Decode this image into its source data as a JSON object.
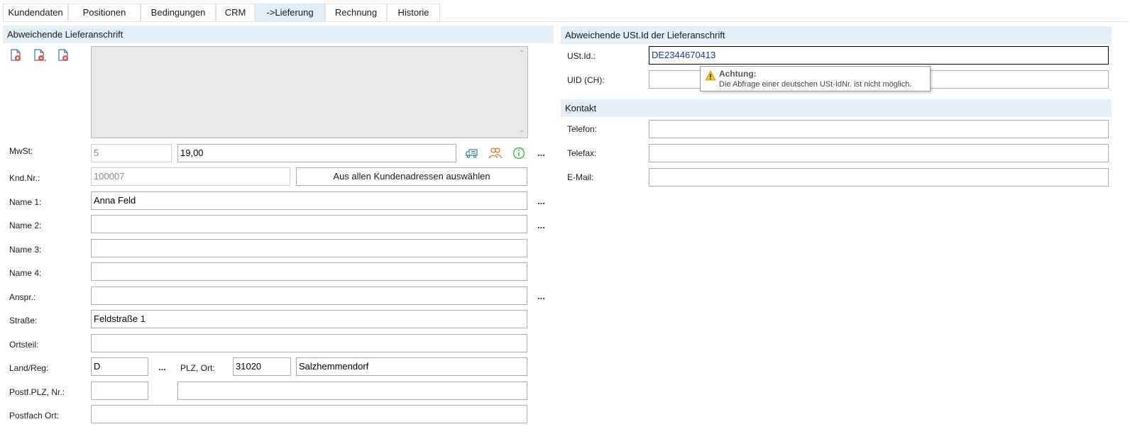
{
  "tabs": [
    {
      "label": "Kundendaten"
    },
    {
      "label": "Positionen"
    },
    {
      "label": "Bedingungen"
    },
    {
      "label": "CRM"
    },
    {
      "label": "->Lieferung"
    },
    {
      "label": "Rechnung"
    },
    {
      "label": "Historie"
    }
  ],
  "active_tab": "->Lieferung",
  "lieferanschrift": {
    "header": "Abweichende Lieferanschrift",
    "toolbar_icons": [
      "document-add-icon",
      "document-copy-icon",
      "document-delete-icon"
    ],
    "mwst": {
      "label": "MwSt:",
      "code": "5",
      "rate": "19,00"
    },
    "kundennr": {
      "label": "Knd.Nr.:",
      "value": "100007",
      "button": "Aus allen Kundenadressen auswählen"
    },
    "name1": {
      "label": "Name 1:",
      "value": "Anna Feld"
    },
    "name2": {
      "label": "Name 2:",
      "value": ""
    },
    "name3": {
      "label": "Name 3:",
      "value": ""
    },
    "name4": {
      "label": "Name 4:",
      "value": ""
    },
    "anspr": {
      "label": "Anspr.:",
      "value": ""
    },
    "strasse": {
      "label": "Straße:",
      "value": "Feldstraße 1"
    },
    "ortsteil": {
      "label": "Ortsteil:",
      "value": ""
    },
    "land": {
      "label": "Land/Reg:",
      "value": "D"
    },
    "plz_ort": {
      "label": "PLZ, Ort:",
      "plz": "31020",
      "ort": "Salzhemmendorf"
    },
    "postfach": {
      "label": "Postf.PLZ, Nr.:",
      "plz": "",
      "nr": ""
    },
    "postfach_ort": {
      "label": "Postfach Ort:",
      "value": ""
    },
    "more_label": "..."
  },
  "ustid": {
    "header": "Abweichende USt.Id der Lieferanschrift",
    "ustid": {
      "label": "USt.Id.:",
      "value": "DE2344670413"
    },
    "uid": {
      "label": "UID (CH):",
      "value": ""
    }
  },
  "kontakt": {
    "header": "Kontakt",
    "telefon": {
      "label": "Telefon:",
      "value": ""
    },
    "telefax": {
      "label": "Telefax:",
      "value": ""
    },
    "email": {
      "label": "E-Mail:",
      "value": ""
    }
  },
  "tooltip": {
    "title": "Achtung:",
    "text": "Die Abfrage einer deutschen USt-IdNr. ist nicht möglich.",
    "icon": "warning-icon"
  },
  "colors": {
    "section_header_bg": "#e3eef7",
    "active_tab_bg": "#e2edf6",
    "focused_text": "#1a33c4",
    "warning": "#f0c419"
  }
}
